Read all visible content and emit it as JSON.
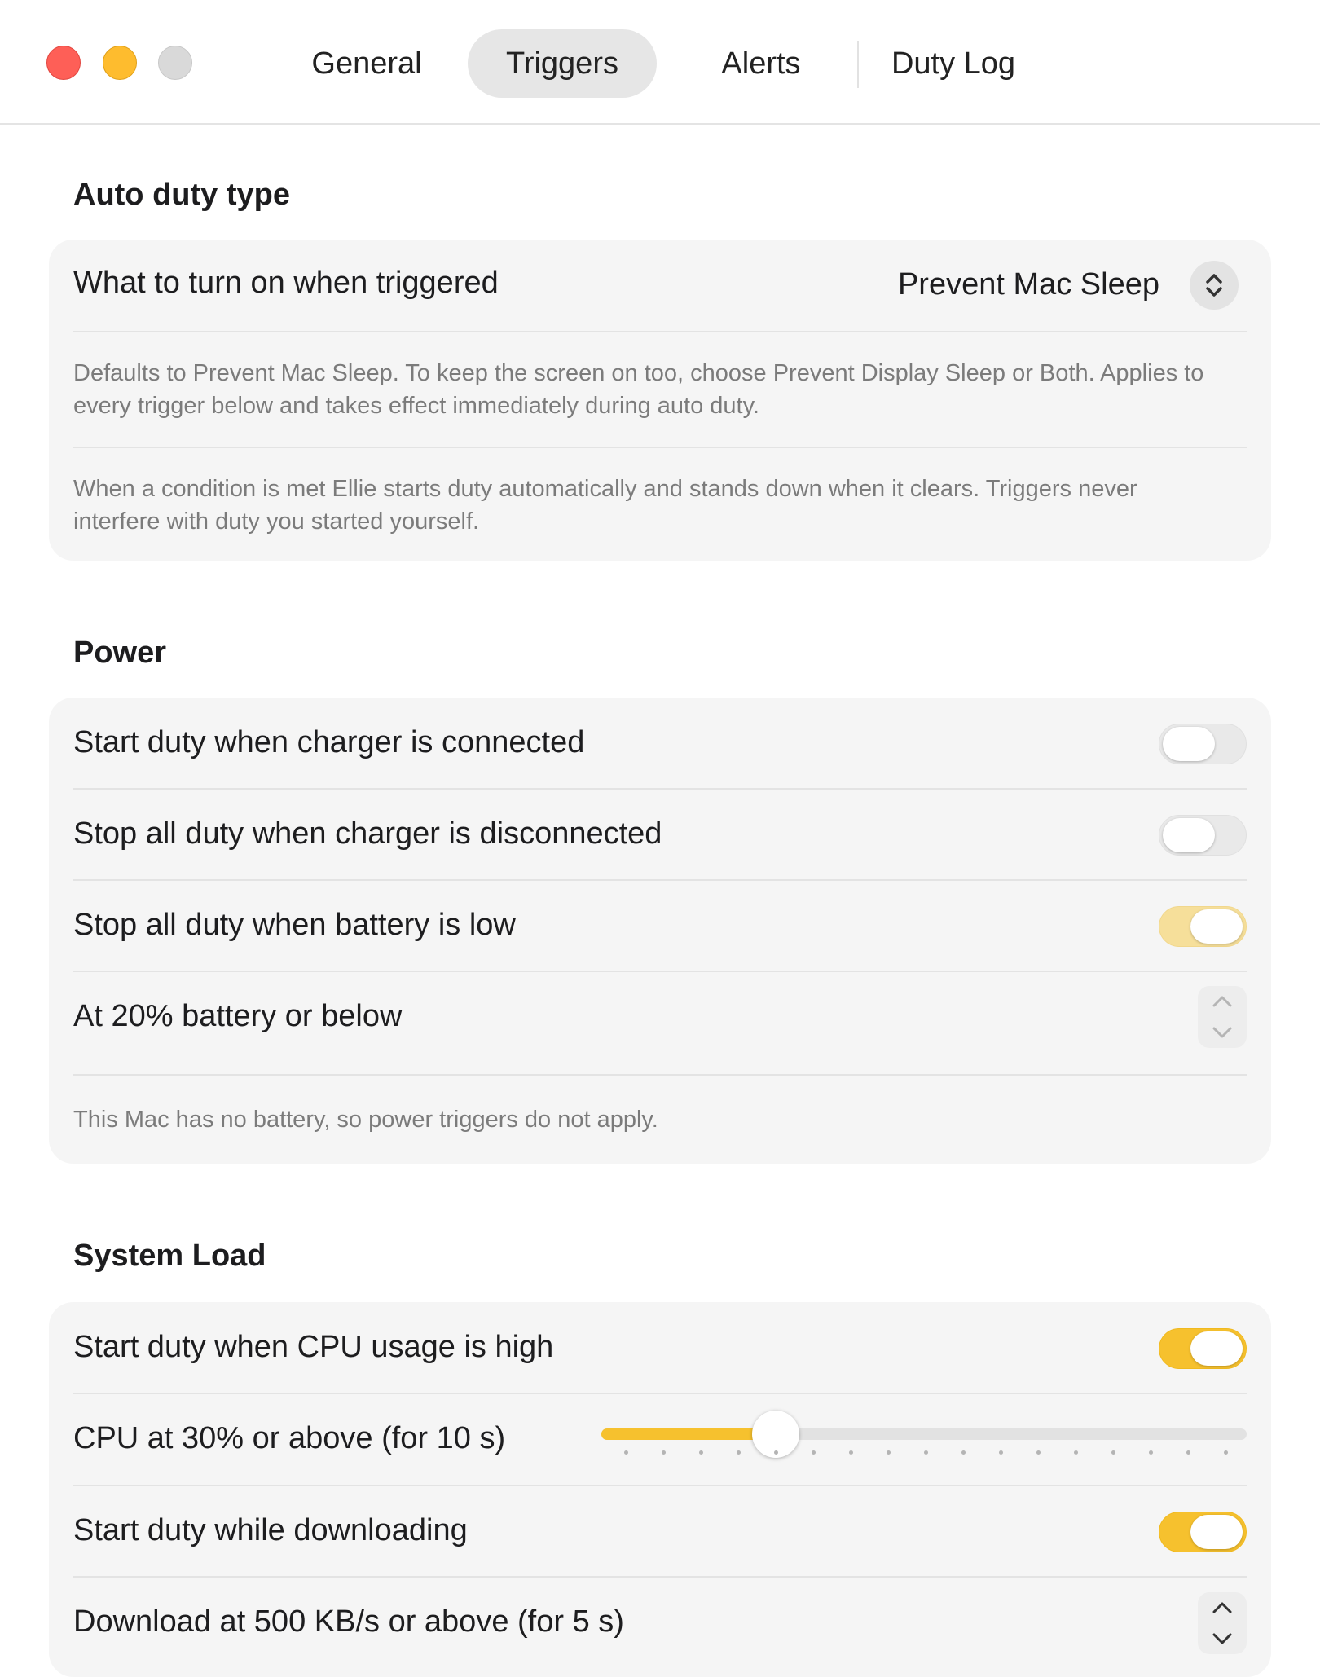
{
  "window": {
    "tabs": [
      {
        "label": "General",
        "active": false
      },
      {
        "label": "Triggers",
        "active": true
      },
      {
        "label": "Alerts",
        "active": false
      },
      {
        "label": "Duty Log",
        "active": false
      }
    ]
  },
  "auto_duty": {
    "section_title": "Auto duty type",
    "row_label": "What to turn on when triggered",
    "selected_value": "Prevent Mac Sleep",
    "note1": "Defaults to Prevent Mac Sleep. To keep the screen on too, choose Prevent Display Sleep or Both. Applies to every trigger below and takes effect immediately during auto duty.",
    "note2": "When a condition is met Ellie starts duty automatically and stands down when it clears. Triggers never interfere with duty you started yourself."
  },
  "power": {
    "section_title": "Power",
    "rows": [
      {
        "label": "Start duty when charger is connected",
        "on": false
      },
      {
        "label": "Stop all duty when charger is disconnected",
        "on": false
      },
      {
        "label": "Stop all duty when battery is low",
        "on": true
      }
    ],
    "stepper_label": "At 20% battery or below",
    "note": "This Mac has no battery, so power triggers do not apply."
  },
  "system_load": {
    "section_title": "System Load",
    "cpu_toggle_label": "Start duty when CPU usage is high",
    "cpu_toggle_on": true,
    "cpu_slider_label": "CPU at 30% or above (for 10 s)",
    "cpu_slider_fraction": 0.27,
    "download_toggle_label": "Start duty while downloading",
    "download_toggle_on": true,
    "download_stepper_label": "Download at 500 KB/s or above (for 5 s)"
  },
  "colors": {
    "accent": "#f6c12e",
    "close": "#fe5f57",
    "minimize": "#febc2e",
    "zoom": "#d9d9d9"
  }
}
